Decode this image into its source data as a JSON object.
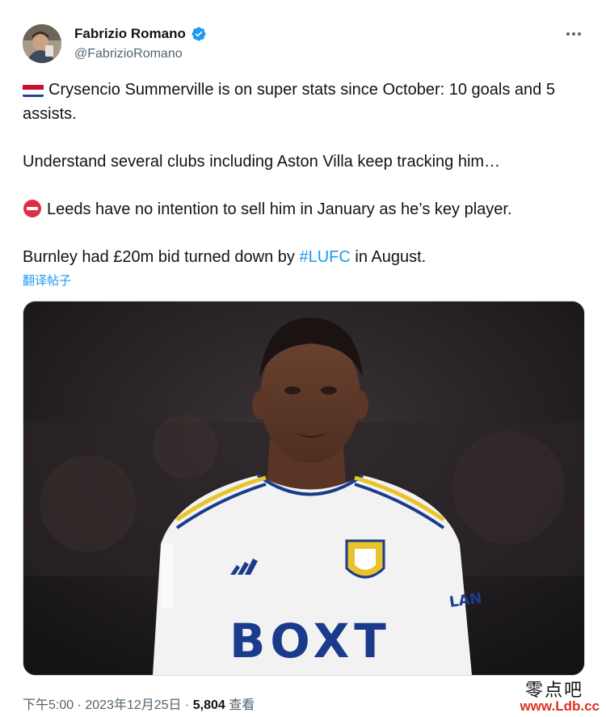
{
  "author": {
    "display_name": "Fabrizio Romano",
    "handle": "@FabrizioRomano"
  },
  "tweet": {
    "line1": "Crysencio Summerville is on super stats since October: 10 goals and 5 assists.",
    "line2": "Understand several clubs including Aston Villa keep tracking him…",
    "line3": "Leeds have no intention to sell him in January as he’s key player.",
    "line4_pre": "Burnley had £20m bid turned down by ",
    "hashtag": "#LUFC",
    "line4_post": " in August.",
    "translate_label": "翻译帖子"
  },
  "media": {
    "jersey_sponsor": "BOXT",
    "sleeve_text": "LAN"
  },
  "meta": {
    "time": "下午5:00 · 2023年12月25日 · ",
    "views": "5,804",
    "views_label": " 查看"
  },
  "watermark": {
    "cn": "零点吧",
    "url": "www.Ldb.cc"
  },
  "colors": {
    "link": "#1d9bf0",
    "verified": "#1d9bf0",
    "secondary_text": "#536471",
    "watermark_url": "#e0301e"
  },
  "icons": [
    "verified-badge-icon",
    "more-options-icon",
    "netherlands-flag-icon",
    "no-entry-icon"
  ]
}
